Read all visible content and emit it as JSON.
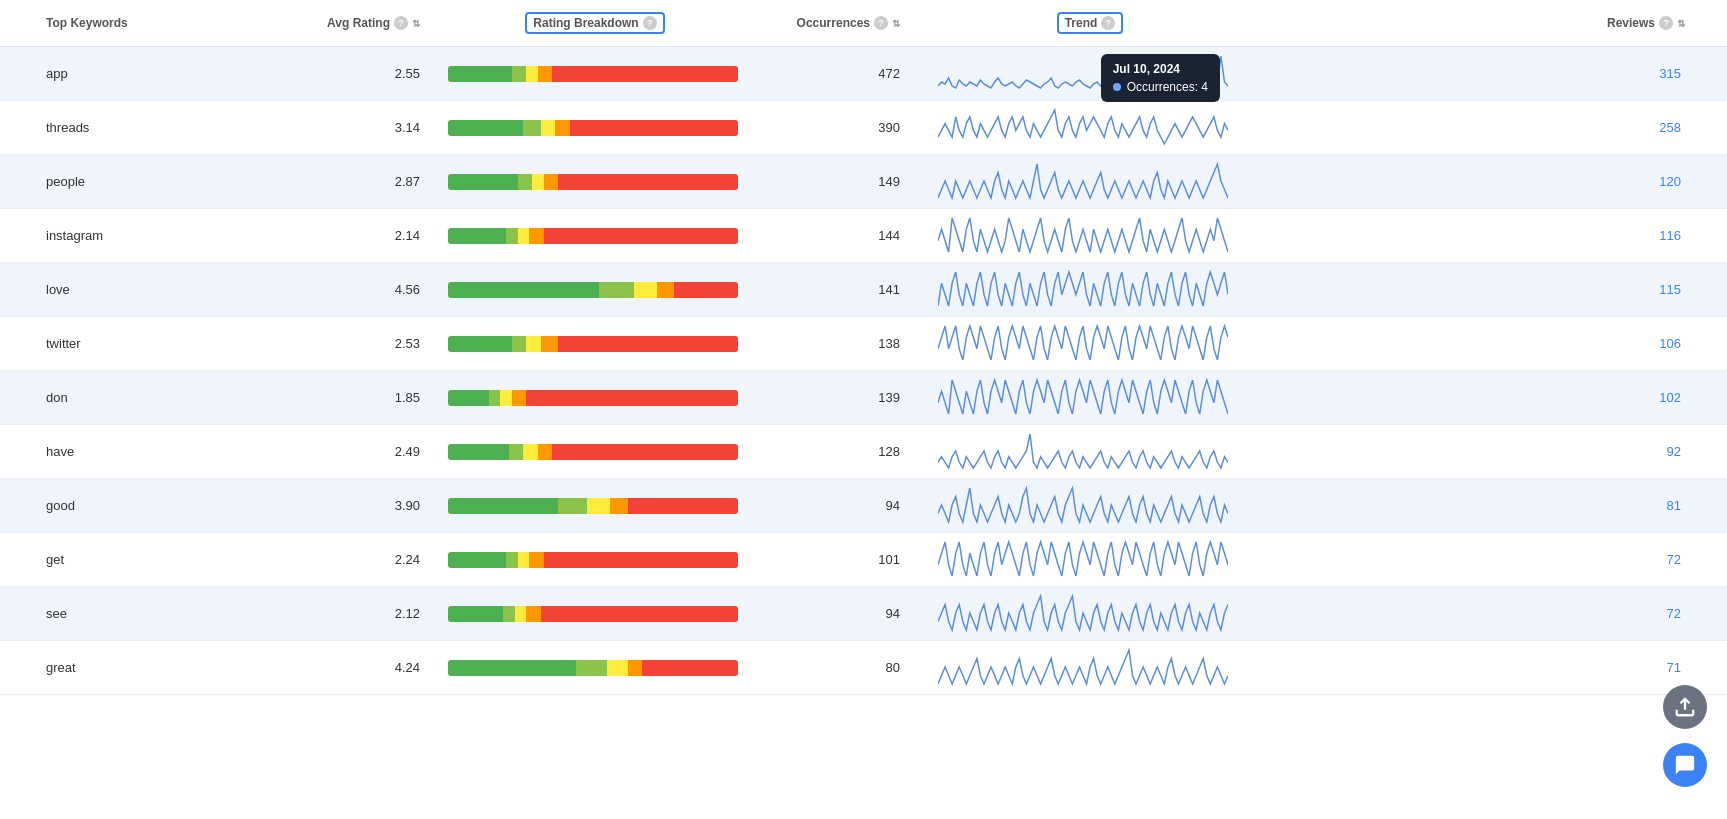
{
  "header": {
    "col_keyword": "Top Keywords",
    "col_avg_rating": "Avg Rating",
    "col_rating_breakdown": "Rating Breakdown",
    "col_occurrences": "Occurrences",
    "col_trend": "Trend",
    "col_reviews": "Reviews"
  },
  "tooltip": {
    "date": "Jul 10, 2024",
    "label": "Occurrences: 4"
  },
  "rows": [
    {
      "keyword": "app",
      "avg_rating": "2.55",
      "occurrences": "472",
      "reviews": "315",
      "bar": [
        {
          "color": "#4caf50",
          "pct": 22
        },
        {
          "color": "#8bc34a",
          "pct": 5
        },
        {
          "color": "#ffeb3b",
          "pct": 4
        },
        {
          "color": "#ff9800",
          "pct": 5
        },
        {
          "color": "#f44336",
          "pct": 64
        }
      ],
      "sparkline": [
        3,
        5,
        4,
        7,
        3,
        2,
        6,
        4,
        3,
        5,
        4,
        3,
        6,
        4,
        3,
        2,
        5,
        7,
        4,
        3,
        4,
        5,
        3,
        2,
        4,
        6,
        5,
        4,
        3,
        2,
        4,
        5,
        7,
        3,
        2,
        4,
        5,
        4,
        3,
        5,
        6,
        4,
        3,
        2,
        4,
        5,
        3,
        4,
        6,
        3,
        2,
        1,
        3,
        4,
        5,
        3,
        2,
        4,
        3,
        2,
        4,
        3,
        5,
        4,
        3,
        2,
        1,
        3,
        4,
        5,
        6,
        3,
        2,
        4,
        3,
        2,
        1,
        2,
        3,
        4,
        18,
        5,
        3
      ]
    },
    {
      "keyword": "threads",
      "avg_rating": "3.14",
      "occurrences": "390",
      "reviews": "258",
      "bar": [
        {
          "color": "#4caf50",
          "pct": 26
        },
        {
          "color": "#8bc34a",
          "pct": 6
        },
        {
          "color": "#ffeb3b",
          "pct": 5
        },
        {
          "color": "#ff9800",
          "pct": 5
        },
        {
          "color": "#f44336",
          "pct": 58
        }
      ],
      "sparkline": [
        2,
        3,
        4,
        3,
        2,
        5,
        3,
        2,
        4,
        5,
        3,
        2,
        4,
        3,
        2,
        3,
        4,
        5,
        3,
        2,
        4,
        5,
        3,
        4,
        5,
        3,
        2,
        4,
        3,
        2,
        3,
        4,
        5,
        6,
        3,
        2,
        4,
        5,
        3,
        2,
        4,
        5,
        3,
        4,
        5,
        4,
        3,
        2,
        4,
        5,
        3,
        2,
        4,
        3,
        2,
        3,
        4,
        5,
        3,
        2,
        4,
        5,
        3,
        2,
        1,
        2,
        3,
        4,
        3,
        2,
        3,
        4,
        5,
        4,
        3,
        2,
        3,
        4,
        5,
        3,
        2,
        4,
        3
      ]
    },
    {
      "keyword": "people",
      "avg_rating": "2.87",
      "occurrences": "149",
      "reviews": "120",
      "bar": [
        {
          "color": "#4caf50",
          "pct": 24
        },
        {
          "color": "#8bc34a",
          "pct": 5
        },
        {
          "color": "#ffeb3b",
          "pct": 4
        },
        {
          "color": "#ff9800",
          "pct": 5
        },
        {
          "color": "#f44336",
          "pct": 62
        }
      ],
      "sparkline": [
        1,
        2,
        3,
        2,
        1,
        3,
        2,
        1,
        2,
        3,
        2,
        1,
        2,
        3,
        2,
        1,
        3,
        4,
        2,
        1,
        3,
        2,
        1,
        2,
        3,
        2,
        1,
        3,
        5,
        2,
        1,
        2,
        3,
        4,
        2,
        1,
        2,
        3,
        2,
        1,
        2,
        3,
        2,
        1,
        2,
        3,
        4,
        2,
        1,
        2,
        3,
        2,
        1,
        2,
        3,
        2,
        1,
        2,
        3,
        2,
        1,
        3,
        4,
        2,
        1,
        3,
        2,
        1,
        2,
        3,
        2,
        1,
        2,
        3,
        2,
        1,
        2,
        3,
        4,
        5,
        3,
        2,
        1
      ]
    },
    {
      "keyword": "instagram",
      "avg_rating": "2.14",
      "occurrences": "144",
      "reviews": "116",
      "bar": [
        {
          "color": "#4caf50",
          "pct": 20
        },
        {
          "color": "#8bc34a",
          "pct": 4
        },
        {
          "color": "#ffeb3b",
          "pct": 4
        },
        {
          "color": "#ff9800",
          "pct": 5
        },
        {
          "color": "#f44336",
          "pct": 67
        }
      ],
      "sparkline": [
        2,
        3,
        2,
        1,
        4,
        3,
        2,
        1,
        3,
        4,
        2,
        1,
        3,
        2,
        1,
        2,
        3,
        2,
        1,
        2,
        4,
        3,
        2,
        1,
        3,
        2,
        1,
        2,
        3,
        4,
        2,
        1,
        2,
        3,
        2,
        1,
        3,
        4,
        2,
        1,
        2,
        3,
        2,
        1,
        3,
        2,
        1,
        2,
        3,
        2,
        1,
        2,
        3,
        2,
        1,
        2,
        3,
        4,
        2,
        1,
        3,
        2,
        1,
        2,
        3,
        2,
        1,
        2,
        3,
        4,
        2,
        1,
        2,
        3,
        2,
        1,
        2,
        3,
        2,
        4,
        3,
        2,
        1
      ]
    },
    {
      "keyword": "love",
      "avg_rating": "4.56",
      "occurrences": "141",
      "reviews": "115",
      "bar": [
        {
          "color": "#4caf50",
          "pct": 52
        },
        {
          "color": "#8bc34a",
          "pct": 12
        },
        {
          "color": "#ffeb3b",
          "pct": 8
        },
        {
          "color": "#ff9800",
          "pct": 6
        },
        {
          "color": "#f44336",
          "pct": 22
        }
      ],
      "sparkline": [
        2,
        4,
        3,
        2,
        4,
        5,
        3,
        2,
        4,
        3,
        2,
        4,
        5,
        3,
        2,
        4,
        5,
        3,
        2,
        4,
        3,
        2,
        4,
        5,
        3,
        2,
        4,
        3,
        2,
        4,
        5,
        3,
        2,
        4,
        5,
        3,
        4,
        5,
        4,
        3,
        4,
        5,
        3,
        2,
        4,
        3,
        2,
        4,
        5,
        3,
        2,
        4,
        5,
        3,
        2,
        4,
        3,
        2,
        4,
        5,
        3,
        2,
        4,
        3,
        2,
        4,
        5,
        3,
        2,
        4,
        5,
        3,
        2,
        4,
        3,
        2,
        4,
        5,
        4,
        3,
        4,
        5,
        3
      ]
    },
    {
      "keyword": "twitter",
      "avg_rating": "2.53",
      "occurrences": "138",
      "reviews": "106",
      "bar": [
        {
          "color": "#4caf50",
          "pct": 22
        },
        {
          "color": "#8bc34a",
          "pct": 5
        },
        {
          "color": "#ffeb3b",
          "pct": 5
        },
        {
          "color": "#ff9800",
          "pct": 6
        },
        {
          "color": "#f44336",
          "pct": 62
        }
      ],
      "sparkline": [
        3,
        4,
        5,
        3,
        4,
        5,
        3,
        2,
        4,
        5,
        4,
        3,
        5,
        4,
        3,
        2,
        4,
        5,
        3,
        2,
        4,
        5,
        4,
        3,
        5,
        4,
        3,
        2,
        4,
        5,
        3,
        2,
        4,
        5,
        4,
        3,
        5,
        4,
        3,
        2,
        4,
        5,
        3,
        2,
        4,
        5,
        4,
        3,
        5,
        4,
        3,
        2,
        4,
        5,
        3,
        2,
        4,
        5,
        4,
        3,
        5,
        4,
        3,
        2,
        4,
        5,
        3,
        2,
        4,
        5,
        4,
        3,
        5,
        4,
        3,
        2,
        4,
        5,
        3,
        2,
        4,
        5,
        4
      ]
    },
    {
      "keyword": "don",
      "avg_rating": "1.85",
      "occurrences": "139",
      "reviews": "102",
      "bar": [
        {
          "color": "#4caf50",
          "pct": 14
        },
        {
          "color": "#8bc34a",
          "pct": 4
        },
        {
          "color": "#ffeb3b",
          "pct": 4
        },
        {
          "color": "#ff9800",
          "pct": 5
        },
        {
          "color": "#f44336",
          "pct": 73
        }
      ],
      "sparkline": [
        3,
        4,
        3,
        2,
        5,
        4,
        3,
        2,
        4,
        3,
        2,
        4,
        5,
        3,
        2,
        4,
        5,
        4,
        3,
        5,
        4,
        3,
        2,
        4,
        5,
        3,
        2,
        4,
        5,
        4,
        3,
        5,
        4,
        3,
        2,
        4,
        5,
        3,
        2,
        4,
        5,
        4,
        3,
        5,
        4,
        3,
        2,
        4,
        5,
        3,
        2,
        4,
        5,
        4,
        3,
        5,
        4,
        3,
        2,
        4,
        5,
        3,
        2,
        4,
        5,
        4,
        3,
        5,
        4,
        3,
        2,
        4,
        5,
        3,
        2,
        4,
        5,
        4,
        3,
        5,
        4,
        3,
        2
      ]
    },
    {
      "keyword": "have",
      "avg_rating": "2.49",
      "occurrences": "128",
      "reviews": "92",
      "bar": [
        {
          "color": "#4caf50",
          "pct": 21
        },
        {
          "color": "#8bc34a",
          "pct": 5
        },
        {
          "color": "#ffeb3b",
          "pct": 5
        },
        {
          "color": "#ff9800",
          "pct": 5
        },
        {
          "color": "#f44336",
          "pct": 64
        }
      ],
      "sparkline": [
        2,
        3,
        2,
        1,
        3,
        4,
        2,
        1,
        3,
        2,
        1,
        2,
        3,
        4,
        2,
        1,
        3,
        4,
        2,
        1,
        3,
        2,
        1,
        2,
        3,
        4,
        7,
        2,
        1,
        3,
        2,
        1,
        2,
        3,
        4,
        2,
        1,
        3,
        4,
        2,
        1,
        3,
        2,
        1,
        2,
        3,
        4,
        2,
        1,
        3,
        2,
        1,
        2,
        3,
        4,
        2,
        1,
        3,
        4,
        2,
        1,
        3,
        2,
        1,
        2,
        3,
        4,
        2,
        1,
        3,
        2,
        1,
        2,
        3,
        4,
        2,
        1,
        3,
        4,
        2,
        1,
        3,
        2
      ]
    },
    {
      "keyword": "good",
      "avg_rating": "3.90",
      "occurrences": "94",
      "reviews": "81",
      "bar": [
        {
          "color": "#4caf50",
          "pct": 38
        },
        {
          "color": "#8bc34a",
          "pct": 10
        },
        {
          "color": "#ffeb3b",
          "pct": 8
        },
        {
          "color": "#ff9800",
          "pct": 6
        },
        {
          "color": "#f44336",
          "pct": 38
        }
      ],
      "sparkline": [
        2,
        3,
        2,
        1,
        3,
        4,
        2,
        1,
        3,
        5,
        2,
        1,
        3,
        2,
        1,
        2,
        3,
        4,
        2,
        1,
        3,
        2,
        1,
        2,
        4,
        5,
        2,
        1,
        3,
        2,
        1,
        2,
        3,
        4,
        2,
        1,
        3,
        4,
        5,
        2,
        1,
        3,
        2,
        1,
        2,
        3,
        4,
        2,
        1,
        3,
        2,
        1,
        2,
        3,
        4,
        2,
        1,
        3,
        4,
        2,
        1,
        3,
        2,
        1,
        2,
        3,
        4,
        2,
        1,
        3,
        2,
        1,
        2,
        3,
        4,
        2,
        1,
        3,
        4,
        2,
        1,
        3,
        2
      ]
    },
    {
      "keyword": "get",
      "avg_rating": "2.24",
      "occurrences": "101",
      "reviews": "72",
      "bar": [
        {
          "color": "#4caf50",
          "pct": 20
        },
        {
          "color": "#8bc34a",
          "pct": 4
        },
        {
          "color": "#ffeb3b",
          "pct": 4
        },
        {
          "color": "#ff9800",
          "pct": 5
        },
        {
          "color": "#f44336",
          "pct": 67
        }
      ],
      "sparkline": [
        3,
        4,
        5,
        3,
        2,
        4,
        5,
        3,
        2,
        4,
        3,
        2,
        4,
        5,
        3,
        2,
        4,
        5,
        3,
        4,
        5,
        4,
        3,
        2,
        4,
        5,
        3,
        2,
        4,
        5,
        4,
        3,
        5,
        4,
        3,
        2,
        4,
        5,
        3,
        2,
        4,
        5,
        4,
        3,
        5,
        4,
        3,
        2,
        4,
        5,
        3,
        2,
        4,
        5,
        4,
        3,
        5,
        4,
        3,
        2,
        4,
        5,
        3,
        2,
        4,
        5,
        4,
        3,
        5,
        4,
        3,
        2,
        4,
        5,
        3,
        2,
        4,
        5,
        4,
        3,
        5,
        4,
        3
      ]
    },
    {
      "keyword": "see",
      "avg_rating": "2.12",
      "occurrences": "94",
      "reviews": "72",
      "bar": [
        {
          "color": "#4caf50",
          "pct": 19
        },
        {
          "color": "#8bc34a",
          "pct": 4
        },
        {
          "color": "#ffeb3b",
          "pct": 4
        },
        {
          "color": "#ff9800",
          "pct": 5
        },
        {
          "color": "#f44336",
          "pct": 68
        }
      ],
      "sparkline": [
        2,
        3,
        4,
        2,
        1,
        3,
        4,
        2,
        1,
        3,
        2,
        1,
        3,
        4,
        2,
        1,
        3,
        4,
        2,
        1,
        3,
        2,
        1,
        3,
        4,
        2,
        1,
        3,
        4,
        5,
        2,
        1,
        3,
        4,
        2,
        1,
        3,
        4,
        5,
        2,
        1,
        3,
        2,
        1,
        3,
        4,
        2,
        1,
        3,
        4,
        2,
        1,
        3,
        2,
        1,
        3,
        4,
        2,
        1,
        3,
        4,
        2,
        1,
        3,
        2,
        1,
        3,
        4,
        2,
        1,
        3,
        4,
        2,
        1,
        3,
        2,
        1,
        3,
        4,
        2,
        1,
        3,
        4
      ]
    },
    {
      "keyword": "great",
      "avg_rating": "4.24",
      "occurrences": "80",
      "reviews": "71",
      "bar": [
        {
          "color": "#4caf50",
          "pct": 44
        },
        {
          "color": "#8bc34a",
          "pct": 11
        },
        {
          "color": "#ffeb3b",
          "pct": 7
        },
        {
          "color": "#ff9800",
          "pct": 5
        },
        {
          "color": "#f44336",
          "pct": 33
        }
      ],
      "sparkline": [
        1,
        2,
        3,
        2,
        1,
        2,
        3,
        2,
        1,
        2,
        3,
        4,
        2,
        1,
        2,
        3,
        2,
        1,
        2,
        3,
        2,
        1,
        3,
        4,
        2,
        1,
        2,
        3,
        2,
        1,
        2,
        3,
        4,
        2,
        1,
        2,
        3,
        2,
        1,
        2,
        3,
        2,
        1,
        3,
        4,
        2,
        1,
        2,
        3,
        2,
        1,
        2,
        3,
        4,
        5,
        2,
        1,
        2,
        3,
        2,
        1,
        2,
        3,
        2,
        1,
        3,
        4,
        2,
        1,
        2,
        3,
        2,
        1,
        2,
        3,
        4,
        2,
        1,
        2,
        3,
        2,
        1,
        2
      ]
    }
  ]
}
